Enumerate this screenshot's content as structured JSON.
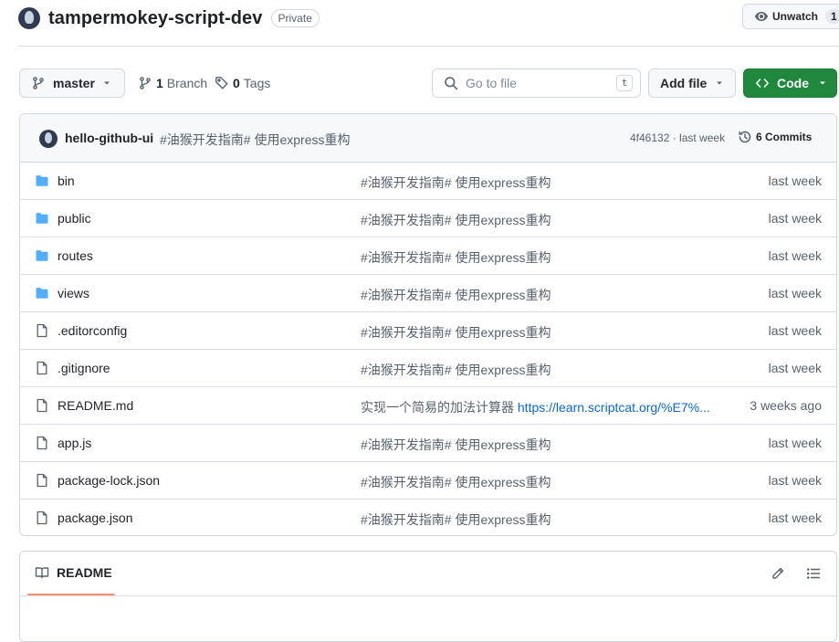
{
  "repo": {
    "name": "tampermokey-script-dev",
    "visibility": "Private",
    "unwatch_label": "Unwatch",
    "watch_count": "1"
  },
  "toolbar": {
    "branch": "master",
    "branch_count": "1",
    "branch_label": "Branch",
    "tag_count": "0",
    "tag_label": "Tags",
    "goto_placeholder": "Go to file",
    "goto_shortcut": "t",
    "add_file_label": "Add file",
    "code_label": "Code"
  },
  "latest_commit": {
    "author": "hello-github-ui",
    "message": "#油猴开发指南# 使用express重构",
    "meta": "4f46132 · last week",
    "commits_label": "6 Commits"
  },
  "files": [
    {
      "type": "folder",
      "name": "bin",
      "message": "#油猴开发指南# 使用express重构",
      "link": "",
      "time": "last week"
    },
    {
      "type": "folder",
      "name": "public",
      "message": "#油猴开发指南# 使用express重构",
      "link": "",
      "time": "last week"
    },
    {
      "type": "folder",
      "name": "routes",
      "message": "#油猴开发指南# 使用express重构",
      "link": "",
      "time": "last week"
    },
    {
      "type": "folder",
      "name": "views",
      "message": "#油猴开发指南# 使用express重构",
      "link": "",
      "time": "last week"
    },
    {
      "type": "file",
      "name": ".editorconfig",
      "message": "#油猴开发指南# 使用express重构",
      "link": "",
      "time": "last week"
    },
    {
      "type": "file",
      "name": ".gitignore",
      "message": "#油猴开发指南# 使用express重构",
      "link": "",
      "time": "last week"
    },
    {
      "type": "file",
      "name": "README.md",
      "message": "实现一个简易的加法计算器 ",
      "link": "https://learn.scriptcat.org/%E7%...",
      "time": "3 weeks ago"
    },
    {
      "type": "file",
      "name": "app.js",
      "message": "#油猴开发指南# 使用express重构",
      "link": "",
      "time": "last week"
    },
    {
      "type": "file",
      "name": "package-lock.json",
      "message": "#油猴开发指南# 使用express重构",
      "link": "",
      "time": "last week"
    },
    {
      "type": "file",
      "name": "package.json",
      "message": "#油猴开发指南# 使用express重构",
      "link": "",
      "time": "last week"
    }
  ],
  "readme": {
    "tab_label": "README"
  },
  "colors": {
    "code_button": "#1f883d",
    "folder_icon": "#54aeff",
    "link": "#0969da",
    "tab_underline": "#fd8c73"
  }
}
